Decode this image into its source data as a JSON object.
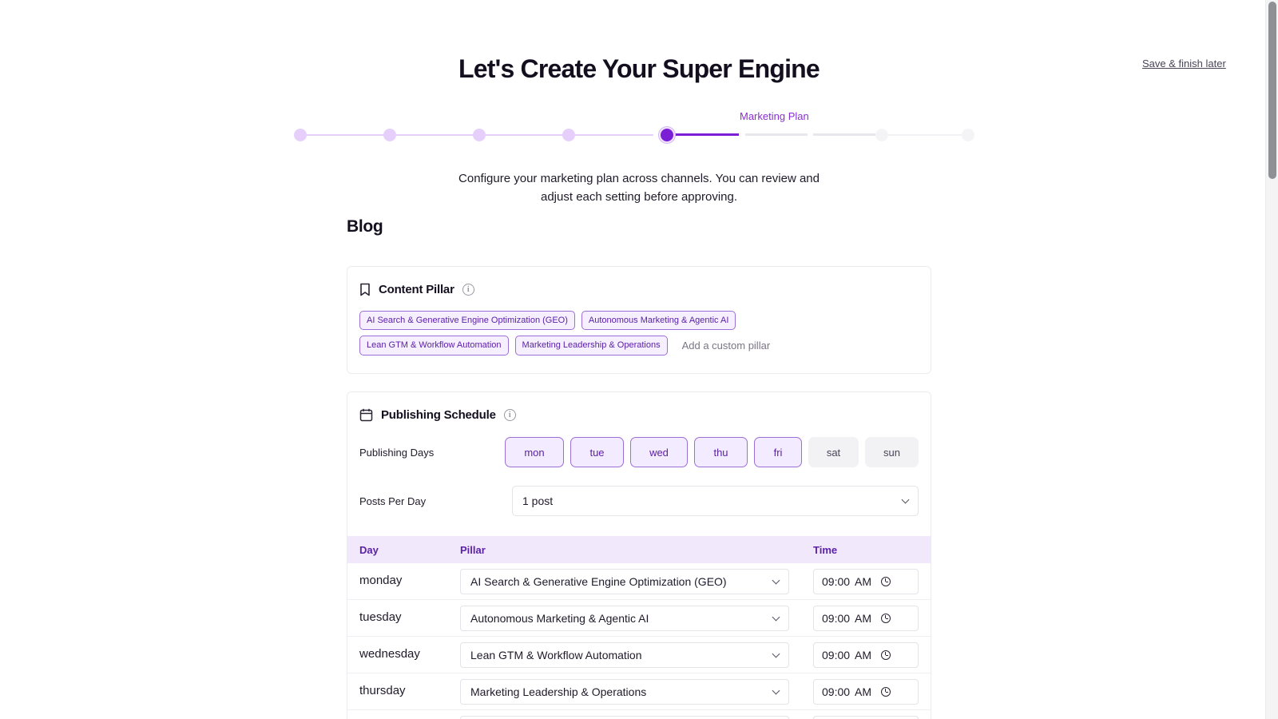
{
  "header": {
    "title": "Let's Create Your Super Engine",
    "save_later": "Save & finish later"
  },
  "stepper": {
    "active_label": "Marketing Plan",
    "current_step": 5,
    "total_steps": 8
  },
  "intro": {
    "line1": "Configure your marketing plan across channels. You can review and",
    "line2": "adjust each setting before approving."
  },
  "section": {
    "title": "Blog"
  },
  "content_pillar": {
    "title": "Content Pillar",
    "info_icon": "info-icon",
    "pillars": [
      "AI Search & Generative Engine Optimization (GEO)",
      "Autonomous Marketing & Agentic AI",
      "Lean GTM & Workflow Automation",
      "Marketing Leadership & Operations"
    ],
    "custom_placeholder": "Add a custom pillar"
  },
  "publishing_schedule": {
    "title": "Publishing Schedule",
    "days_label": "Publishing Days",
    "days": [
      {
        "label": "mon",
        "selected": true
      },
      {
        "label": "tue",
        "selected": true
      },
      {
        "label": "wed",
        "selected": true
      },
      {
        "label": "thu",
        "selected": true
      },
      {
        "label": "fri",
        "selected": true
      },
      {
        "label": "sat",
        "selected": false
      },
      {
        "label": "sun",
        "selected": false
      }
    ],
    "posts_label": "Posts Per Day",
    "posts_value": "1 post",
    "table": {
      "headers": {
        "day": "Day",
        "pillar": "Pillar",
        "time": "Time"
      },
      "rows": [
        {
          "day": "monday",
          "pillar": "AI Search & Generative Engine Optimization (GEO)",
          "time": "09:00",
          "ampm": "AM"
        },
        {
          "day": "tuesday",
          "pillar": "Autonomous Marketing & Agentic AI",
          "time": "09:00",
          "ampm": "AM"
        },
        {
          "day": "wednesday",
          "pillar": "Lean GTM & Workflow Automation",
          "time": "09:00",
          "ampm": "AM"
        },
        {
          "day": "thursday",
          "pillar": "Marketing Leadership & Operations",
          "time": "09:00",
          "ampm": "AM"
        }
      ]
    }
  },
  "colors": {
    "accent": "#7b1fd6",
    "accent_text": "#5b21a6",
    "chip_bg": "#f5efff",
    "table_head_bg": "#f1e9fb"
  }
}
